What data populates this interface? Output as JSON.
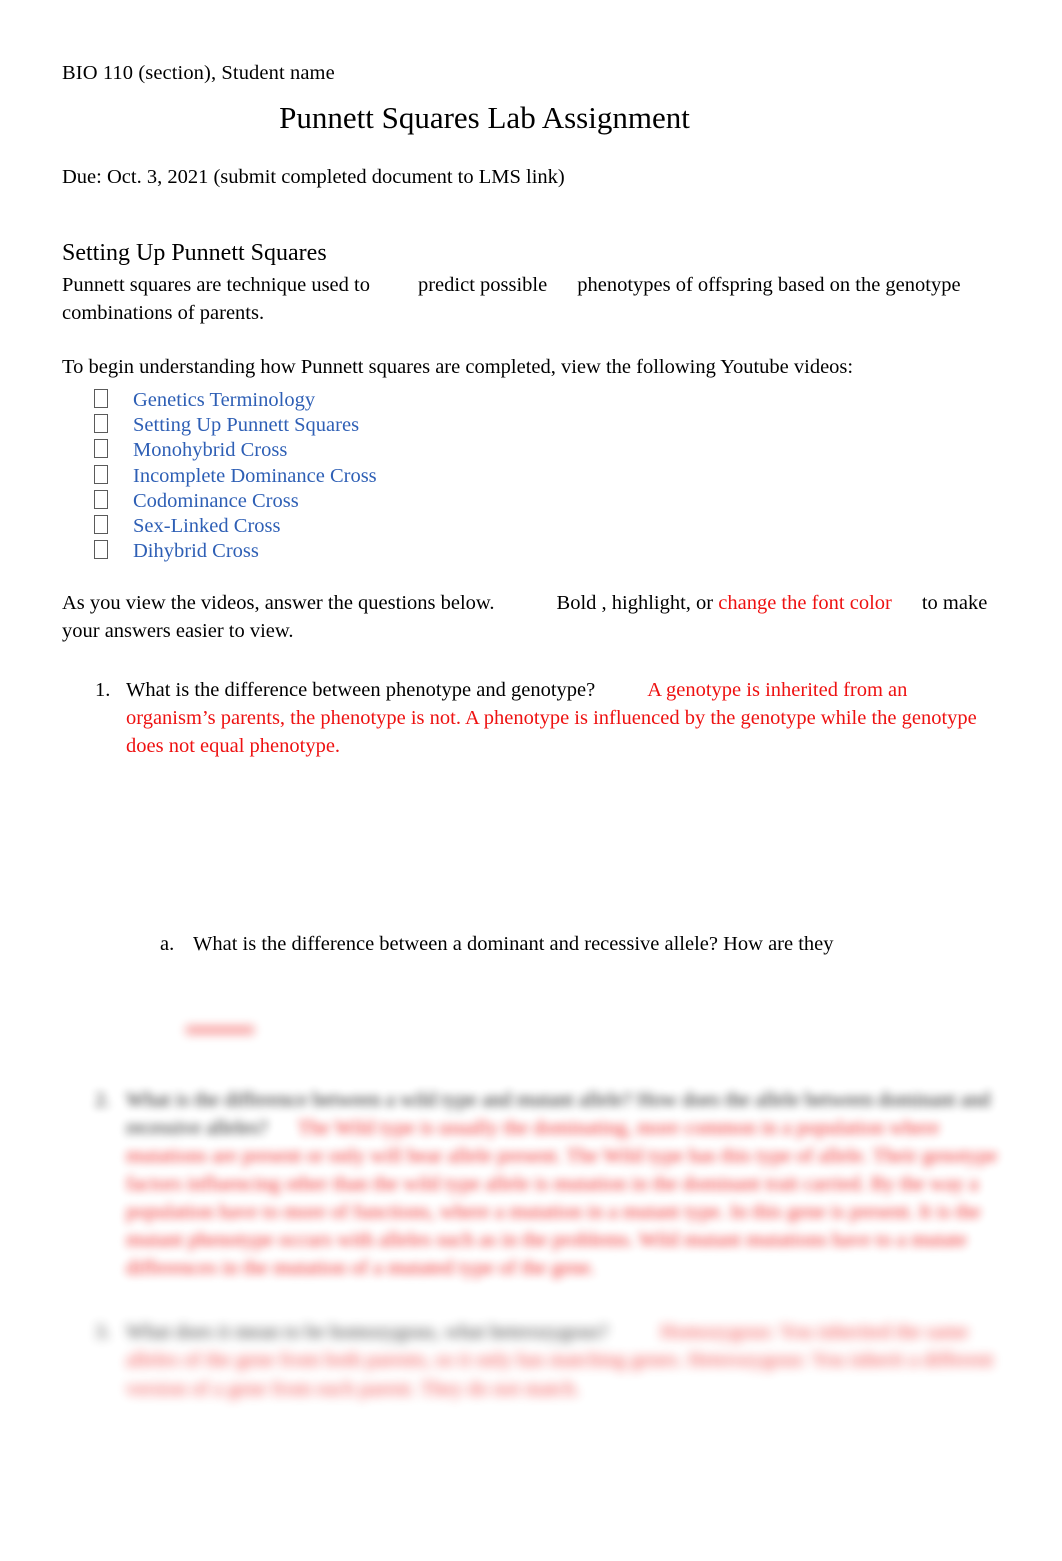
{
  "document": {
    "header": "BIO 110 (section), Student name",
    "title": "Punnett Squares Lab Assignment",
    "due_line": "Due:  Oct. 3, 2021 (submit completed document to LMS link)"
  },
  "section": {
    "heading": "Setting Up Punnett Squares",
    "intro_part1": "Punnett squares are technique used to",
    "intro_part2": "predict possible",
    "intro_part3": "phenotypes of offspring based on the genotype combinations of parents.",
    "videos_lead": "To begin understanding how Punnett squares are completed, view the following Youtube videos:"
  },
  "video_links": [
    {
      "label": "Genetics Terminology",
      "bullet": "tofu-bullet-icon"
    },
    {
      "label": "Setting Up Punnett Squares",
      "bullet": "tofu-bullet-icon"
    },
    {
      "label": "Monohybrid Cross",
      "bullet": "tofu-bullet-icon"
    },
    {
      "label": "Incomplete Dominance Cross",
      "bullet": "tofu-bullet-icon"
    },
    {
      "label": "Codominance Cross",
      "bullet": "tofu-bullet-icon"
    },
    {
      "label": "Sex-Linked Cross",
      "bullet": "tofu-bullet-icon"
    },
    {
      "label": "Dihybrid Cross",
      "bullet": "tofu-bullet-icon"
    }
  ],
  "instructions": {
    "part1": "As you view the videos, answer the questions below.",
    "bold_word": "Bold",
    "part2": ", highlight, or",
    "colored_phrase": "change the font color",
    "part3": "to make your answers easier to view."
  },
  "questions": [
    {
      "number": "1.",
      "prompt": "What is the difference between phenotype and genotype?",
      "answer": "A genotype is inherited from an organism’s parents, the phenotype is not. A phenotype is influenced by the genotype while the genotype does not equal phenotype."
    }
  ],
  "subquestions": [
    {
      "letter": "a.",
      "prompt": "What is the difference between a dominant and recessive allele? How are they"
    }
  ],
  "blurred_questions": [
    {
      "number": "2.",
      "prompt": "What is the difference between a wild type and mutant allele? How does the allele between dominant and recessive alleles?",
      "answer": "The Wild type is usually the dominating, more common in a population where mutations are present or only will bear allele present. The Wild type has this type of allele. Their genotype factors influencing other than the wild type allele is mutation in the dominant trait carried. By the way a population have to more of functions, where a mutation in a mutant type. In this gene is present. It is the mutant phenotype occurs with alleles such as in the problems. Wild mutant mutations have to a mutate differences in the mutation of a mutated type of the gene."
    },
    {
      "number": "3.",
      "prompt": "What does it mean to be homozygous, what heterozygous?",
      "answer": "Homozygous: You inherited the same alleles of the gene from both parents, so it only has matching genes. Heterozygous: You inherit a different version of a gene from each parent. They do not match."
    }
  ],
  "colors": {
    "link_blue": "#2E5FB5",
    "answer_red": "#ee1111",
    "text_black": "#000000",
    "page_background": "#ffffff"
  }
}
